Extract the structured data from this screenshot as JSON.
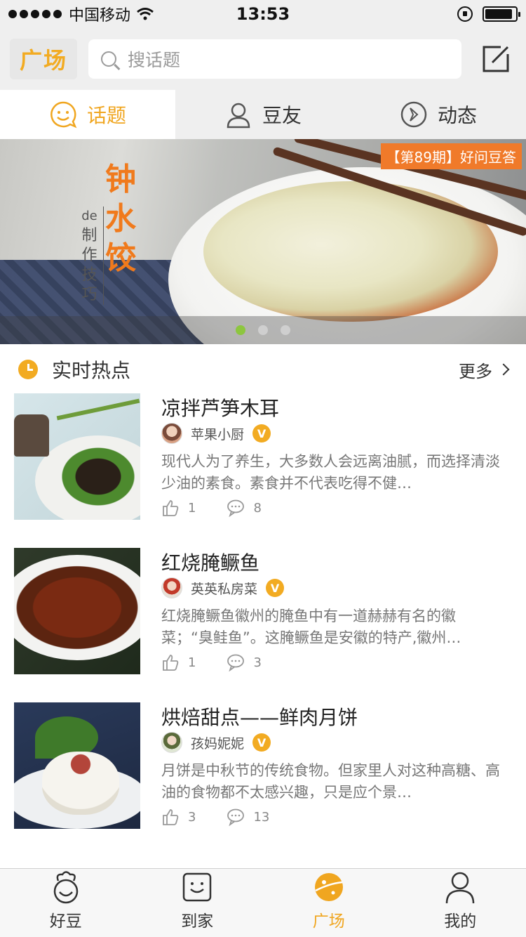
{
  "status_bar": {
    "carrier": "中国移动",
    "time": "13:53",
    "battery_level": 0.9
  },
  "header": {
    "logo_text": "广场",
    "search_placeholder": "搜话题",
    "compose_icon": "edit-icon"
  },
  "tabs": [
    {
      "label": "话题",
      "icon": "chat-smile-icon",
      "active": true
    },
    {
      "label": "豆友",
      "icon": "person-icon",
      "active": false
    },
    {
      "label": "动态",
      "icon": "compass-icon",
      "active": false
    }
  ],
  "banner": {
    "tag": "【第89期】好问豆答",
    "title_chars": [
      "钟",
      "水",
      "饺"
    ],
    "subtitle_chars": [
      "de",
      "制",
      "作",
      "技",
      "巧"
    ],
    "slides_total": 3,
    "active_slide": 0
  },
  "hot": {
    "title": "实时热点",
    "more_label": "更多",
    "articles": [
      {
        "title": "凉拌芦笋木耳",
        "author": "苹果小厨",
        "verified": "V",
        "desc": "现代人为了养生，大多数人会远离油腻，而选择清淡少油的素食。素食并不代表吃得不健…",
        "likes": "1",
        "comments": "8"
      },
      {
        "title": "红烧腌鳜鱼",
        "author": "英英私房菜",
        "verified": "V",
        "desc": "红烧腌鳜鱼徽州的腌鱼中有一道赫赫有名的徽菜；“臭鲑鱼”。这腌鳜鱼是安徽的特产,徽州…",
        "likes": "1",
        "comments": "3"
      },
      {
        "title": "烘焙甜点——鲜肉月饼",
        "author": "孩妈妮妮",
        "verified": "V",
        "desc": "月饼是中秋节的传统食物。但家里人对这种高糖、高油的食物都不太感兴趣，只是应个景…",
        "likes": "3",
        "comments": "13"
      }
    ]
  },
  "tabbar": [
    {
      "label": "好豆",
      "icon": "chef-icon",
      "active": false
    },
    {
      "label": "到家",
      "icon": "bag-smile-icon",
      "active": false
    },
    {
      "label": "广场",
      "icon": "planet-icon",
      "active": true
    },
    {
      "label": "我的",
      "icon": "profile-icon",
      "active": false
    }
  ],
  "colors": {
    "accent": "#f0a620",
    "verified": "#f2ab22",
    "banner_tag": "#f07a2a",
    "dot_active": "#8dc63f"
  }
}
